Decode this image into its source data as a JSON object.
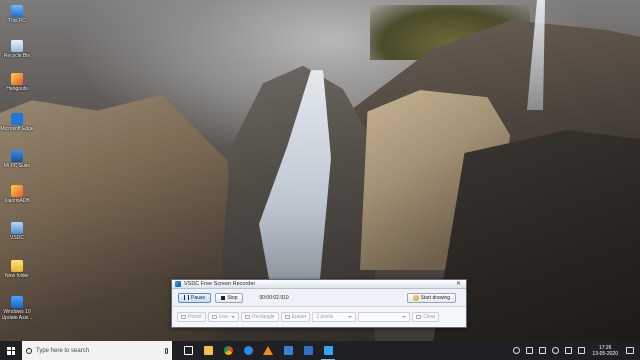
{
  "desktop": {
    "icons": [
      {
        "label": "This PC",
        "icon": "this-pc-icon"
      },
      {
        "label": "Recycle Bin",
        "icon": "recycle-bin-icon"
      },
      {
        "label": "Hangouts",
        "icon": "app-icon"
      },
      {
        "label": "Microsoft Edge",
        "icon": "edge-icon"
      },
      {
        "label": "Mi PC Suite",
        "icon": "pc-suite-icon"
      },
      {
        "label": "XiaomiADB",
        "icon": "xiaomi-adb-icon"
      },
      {
        "label": "VSDC",
        "icon": "vsdc-icon"
      },
      {
        "label": "New folder",
        "icon": "folder-icon"
      },
      {
        "label": "Windows 10 Update Assi...",
        "icon": "windows-update-icon"
      }
    ]
  },
  "recorder": {
    "title": "VSDC Free Screen Recorder",
    "close_label": "✕",
    "pause_label": "Pause",
    "stop_label": "Stop",
    "timer": "00:00:02.910",
    "start_drawing_label": "Start drawing",
    "tools": {
      "pencil_label": "Pencil",
      "line_label": "Line",
      "rectangle_label": "Rectangle",
      "eraser_label": "Eraser",
      "size_value": "2 pixels",
      "color_value": "",
      "clear_label": "Clear"
    }
  },
  "taskbar": {
    "search_placeholder": "Type here to search",
    "apps": [
      "task-view",
      "file-explorer",
      "chrome",
      "edge",
      "vlc",
      "store",
      "mail",
      "vsdc"
    ],
    "clock_time": "17:26",
    "clock_date": "13-05-2020"
  }
}
